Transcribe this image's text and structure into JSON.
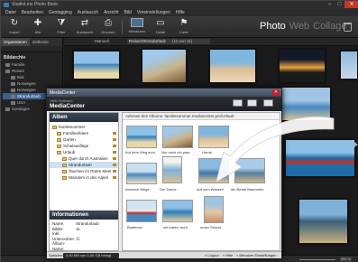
{
  "window": {
    "title": "StudioLine Photo Basic",
    "controls": [
      "–",
      "□",
      "✕"
    ]
  },
  "menu": [
    "Datei",
    "Bearbeiten",
    "Geotagging",
    "Austausch",
    "Ansicht",
    "Bild",
    "Voreinstellungen",
    "Hilfe"
  ],
  "toolbar": {
    "buttons": [
      {
        "label": "Import",
        "icon": "↻"
      },
      {
        "label": "Alle",
        "icon": "✚"
      },
      {
        "label": "Filter",
        "icon": "⧩"
      },
      {
        "label": "Austausch",
        "icon": "⇄"
      },
      {
        "label": "Drucken",
        "icon": "⎙"
      },
      {
        "label": "Miniaturen",
        "icon": ""
      },
      {
        "label": "Detail",
        "icon": "▭"
      },
      {
        "label": "Karte",
        "icon": "⚑"
      }
    ],
    "view_tabs": [
      "Photo",
      "Web",
      "Collage"
    ]
  },
  "left_panel": {
    "tabs": [
      "Organisieren",
      "Zeitleiste"
    ],
    "section": "Bildarchiv",
    "nodes": [
      "Familie",
      "Reisen",
      "Bali",
      "Norwegen",
      "Norwegen",
      "Strandurlaub",
      "USA",
      "Sonstiges"
    ]
  },
  "content": {
    "sort": "Manuell",
    "path": "Reisen\\Strandurlaub",
    "count": "(11 von 11)"
  },
  "statusbar": {
    "zoom": "200 %"
  },
  "dialog": {
    "title": "MediaCenter",
    "brand": "H&M Software",
    "product": "MediaCenter",
    "albums_header": "Alben",
    "address": "Adresse des Albums: familiesommer.mediacenter.pro/Urlaub",
    "albums": [
      "familiesommer",
      "Familienfeiern",
      "Garten",
      "Schulausflüge",
      "Urlaub",
      "Quer durch Australien",
      "Strandurlaub",
      "Tauchen im Roten Meer",
      "Wandern in den Alpen"
    ],
    "info_header": "Informationen",
    "info": [
      {
        "k": "Name:",
        "v": "Strandurlaub"
      },
      {
        "k": "Bilder:",
        "v": "11"
      },
      {
        "k": "Inkl. Unterordner:",
        "v": "11"
      },
      {
        "k": "Album-Name:",
        "v": ""
      }
    ],
    "thumbs": [
      "Auf dem Weg zum",
      "Nur noch ein paar",
      "Hurra!",
      "einsame Wege",
      "Die Sonne",
      "Auf zum Wasser!",
      "der Beste Bauernels",
      "Badebuci",
      "wir haben auch",
      "unser Strand-"
    ],
    "footer": {
      "storage_label": "Speicher",
      "storage_value": "0,00 MB von 1,00 GB belegt",
      "logout": "» Logout",
      "help": "» Hilfe",
      "settings": "» Benutzer Einstellungen"
    }
  },
  "colors": {
    "accent": "#3b5f8c",
    "dialog_header": "#26303c"
  }
}
